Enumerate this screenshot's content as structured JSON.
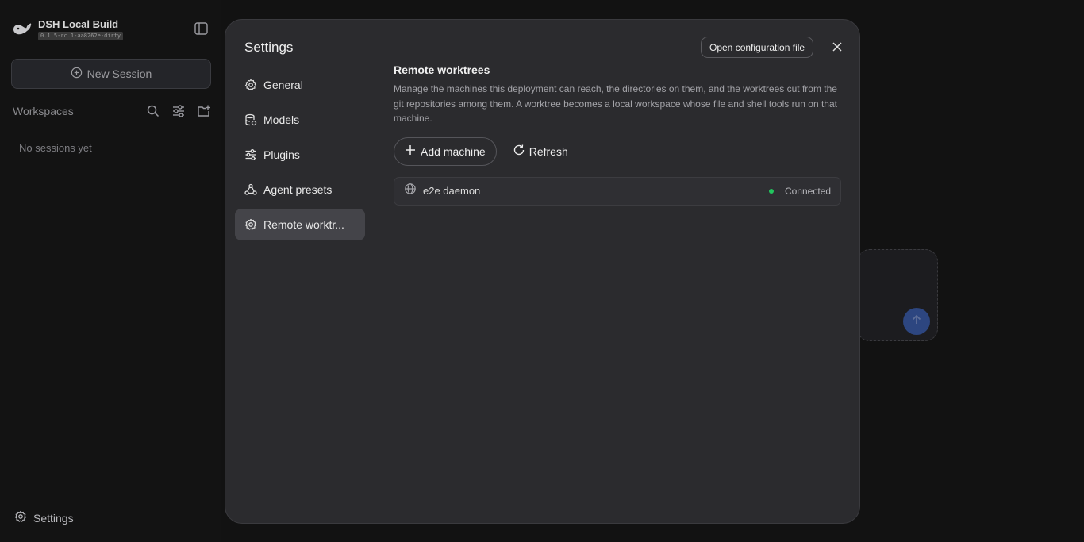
{
  "app": {
    "name": "DSH Local Build",
    "version": "0.1.5-rc.1-aa8262e-dirty",
    "logo_icon": "whale-logo-icon",
    "sidebar_toggle_icon": "sidebar-toggle-icon"
  },
  "sidebar": {
    "new_session_label": "New Session",
    "new_session_icon": "plus-circle-icon",
    "workspaces_title": "Workspaces",
    "workspace_icons": [
      "search-icon",
      "filter-sliders-icon",
      "new-folder-icon"
    ],
    "empty_text": "No sessions yet",
    "settings_label": "Settings",
    "settings_icon": "gear-icon"
  },
  "settings_modal": {
    "title": "Settings",
    "open_config_label": "Open configuration file",
    "close_icon": "close-icon",
    "nav": [
      {
        "label": "General",
        "icon": "gear-icon",
        "active": false
      },
      {
        "label": "Models",
        "icon": "database-icon",
        "active": false
      },
      {
        "label": "Plugins",
        "icon": "sliders-icon",
        "active": false
      },
      {
        "label": "Agent presets",
        "icon": "agents-icon",
        "active": false
      },
      {
        "label": "Remote worktr...",
        "icon": "gear-icon",
        "active": true
      }
    ],
    "section": {
      "title": "Remote worktrees",
      "description": "Manage the machines this deployment can reach, the directories on them, and the worktrees cut from the git repositories among them. A worktree becomes a local workspace whose file and shell tools run on that machine.",
      "add_machine_label": "Add machine",
      "refresh_label": "Refresh",
      "machines": [
        {
          "name": "e2e daemon",
          "status": "Connected",
          "icon": "globe-icon",
          "status_color": "#22c55e"
        }
      ]
    }
  },
  "colors": {
    "background": "#121212",
    "modal": "#2b2b2e",
    "active_nav": "#444449",
    "send_button": "#2d4680"
  }
}
